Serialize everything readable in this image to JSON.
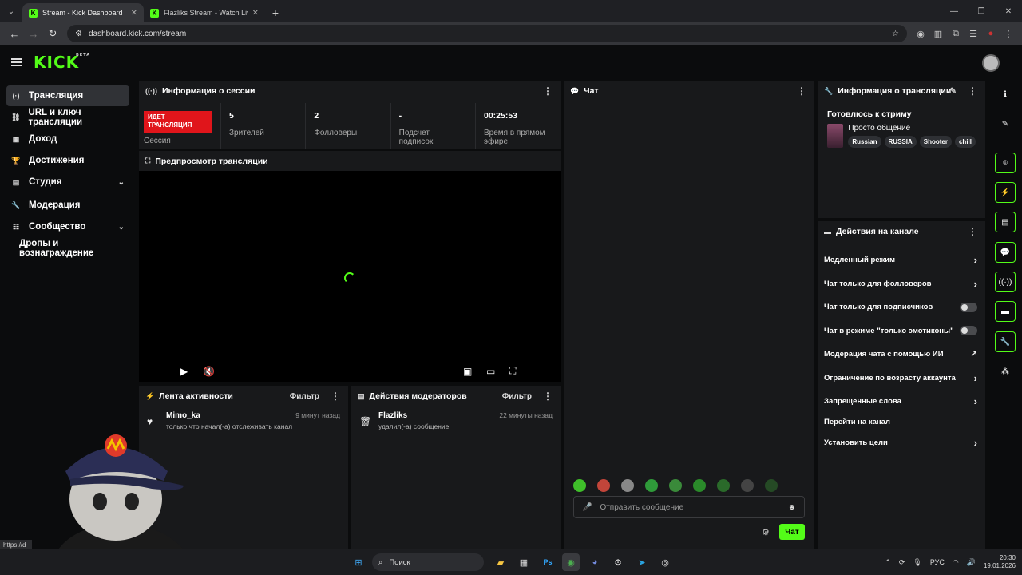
{
  "browser": {
    "tabs": [
      {
        "title": "Stream - Kick Dashboard",
        "active": true
      },
      {
        "title": "Flazliks Stream - Watch Live on",
        "active": false
      }
    ],
    "url": "dashboard.kick.com/stream"
  },
  "header": {
    "logo": "KICK",
    "logo_badge": "BETA"
  },
  "sidebar": {
    "items": [
      {
        "label": "Трансляция",
        "icon": "broadcast-icon"
      },
      {
        "label": "URL и ключ трансляции",
        "icon": "link-icon"
      },
      {
        "label": "Доход",
        "icon": "chart-icon"
      },
      {
        "label": "Достижения",
        "icon": "trophy-icon"
      },
      {
        "label": "Студия",
        "icon": "studio-icon"
      },
      {
        "label": "Модерация",
        "icon": "wrench-icon"
      },
      {
        "label": "Сообщество",
        "icon": "community-icon"
      },
      {
        "label": "Дропы и вознаграждение",
        "icon": ""
      }
    ]
  },
  "session": {
    "title": "Информация о сессии",
    "live_badge": "ИДЕТ ТРАНСЛЯЦИЯ",
    "session_label": "Сессия",
    "stats": [
      {
        "value": "5",
        "label": "Зрителей"
      },
      {
        "value": "2",
        "label": "Фолловеры"
      },
      {
        "value": "-",
        "label": "Подсчет подписок"
      },
      {
        "value": "00:25:53",
        "label": "Время в прямом эфире"
      }
    ]
  },
  "preview": {
    "title": "Предпросмотр трансляции"
  },
  "activity": {
    "title": "Лента активности",
    "filter": "Фильтр",
    "items": [
      {
        "name": "Mimo_ka",
        "desc": "только что начал(-а) отслеживать канал",
        "time": "9 минут назад"
      }
    ]
  },
  "modactions": {
    "title": "Действия модераторов",
    "filter": "Фильтр",
    "items": [
      {
        "name": "Flazliks",
        "desc": "удалил(-а) сообщение",
        "time": "22 минуты назад"
      }
    ]
  },
  "chat": {
    "title": "Чат",
    "placeholder": "Отправить сообщение",
    "send": "Чат"
  },
  "stream_info": {
    "title": "Информация о трансляции",
    "stream_title": "Готовлюсь к стриму",
    "category": "Просто общение",
    "tags": [
      "Russian",
      "RUSSIA",
      "Shooter",
      "chill"
    ]
  },
  "channel_actions": {
    "title": "Действия на канале",
    "items": [
      {
        "label": "Медленный режим",
        "control": "arrow"
      },
      {
        "label": "Чат только для фолловеров",
        "control": "arrow"
      },
      {
        "label": "Чат только для подписчиков",
        "control": "toggle"
      },
      {
        "label": "Чат в режиме \"только эмотиконы\"",
        "control": "toggle"
      },
      {
        "label": "Модерация чата с помощью ИИ",
        "control": "external"
      },
      {
        "label": "Ограничение по возрасту аккаунта",
        "control": "arrow"
      },
      {
        "label": "Запрещенные слова",
        "control": "arrow"
      },
      {
        "label": "Перейти на канал",
        "control": "none"
      },
      {
        "label": "Установить цели",
        "control": "arrow"
      }
    ]
  },
  "statusbar": {
    "url": "https://d"
  },
  "taskbar": {
    "search": "Поиск",
    "lang": "РУС",
    "time": "20:30",
    "date": "19.01.2026"
  },
  "colors": {
    "accent": "#53fc18",
    "live": "#e0151b",
    "panel": "#18191b",
    "bg": "#0b0c0d"
  }
}
